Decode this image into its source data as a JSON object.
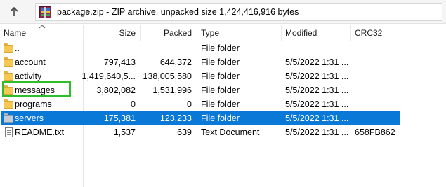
{
  "toolbar": {
    "path": "package.zip - ZIP archive, unpacked size 1,424,416,916 bytes"
  },
  "columns": {
    "name": "Name",
    "size": "Size",
    "packed": "Packed",
    "type": "Type",
    "modified": "Modified",
    "crc": "CRC32"
  },
  "rows": [
    {
      "name": "..",
      "size": "",
      "packed": "",
      "type": "File folder",
      "modified": "",
      "crc": ""
    },
    {
      "name": "account",
      "size": "797,413",
      "packed": "644,372",
      "type": "File folder",
      "modified": "5/5/2022 1:31 ...",
      "crc": ""
    },
    {
      "name": "activity",
      "size": "1,419,640,5...",
      "packed": "138,005,580",
      "type": "File folder",
      "modified": "5/5/2022 1:31 ...",
      "crc": ""
    },
    {
      "name": "messages",
      "size": "3,802,082",
      "packed": "1,531,996",
      "type": "File folder",
      "modified": "5/5/2022 1:31 ...",
      "crc": ""
    },
    {
      "name": "programs",
      "size": "0",
      "packed": "0",
      "type": "File folder",
      "modified": "5/5/2022 1:31 ...",
      "crc": ""
    },
    {
      "name": "servers",
      "size": "175,381",
      "packed": "123,233",
      "type": "File folder",
      "modified": "5/5/2022 1:31 ...",
      "crc": ""
    },
    {
      "name": "README.txt",
      "size": "1,537",
      "packed": "639",
      "type": "Text Document",
      "modified": "5/5/2022 1:31 ...",
      "crc": "658FB862"
    }
  ],
  "colors": {
    "selection": "#0a78d7",
    "highlight_box": "#2fbe29",
    "folder": "#f6c751"
  },
  "icons": [
    "up-arrow-icon",
    "zip-archive-icon",
    "folder-icon",
    "text-file-icon",
    "sort-arrow-icon"
  ]
}
